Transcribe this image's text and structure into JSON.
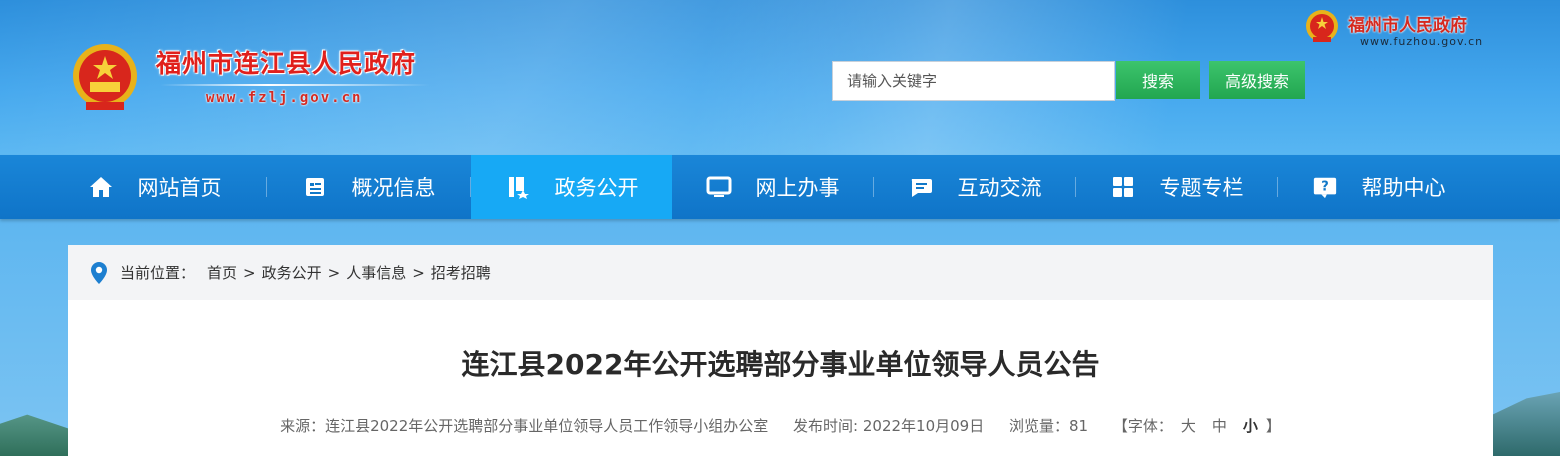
{
  "header": {
    "site_title": "福州市连江县人民政府",
    "site_url": "www.fzlj.gov.cn",
    "parent_site_title": "福州市人民政府",
    "parent_site_url": "www.fuzhou.gov.cn"
  },
  "search": {
    "placeholder": "请输入关键字",
    "value": "",
    "search_label": "搜索",
    "advanced_label": "高级搜索"
  },
  "nav": {
    "items": [
      {
        "label": "网站首页",
        "icon": "home-icon"
      },
      {
        "label": "概况信息",
        "icon": "document-icon"
      },
      {
        "label": "政务公开",
        "icon": "book-icon",
        "active": true
      },
      {
        "label": "网上办事",
        "icon": "monitor-icon"
      },
      {
        "label": "互动交流",
        "icon": "chat-icon"
      },
      {
        "label": "专题专栏",
        "icon": "grid-icon"
      },
      {
        "label": "帮助中心",
        "icon": "help-icon"
      }
    ]
  },
  "breadcrumb": {
    "prefix": "当前位置：",
    "items": [
      "首页",
      "政务公开",
      "人事信息",
      "招考招聘"
    ],
    "separator": ">"
  },
  "article": {
    "title": "连江县2022年公开选聘部分事业单位领导人员公告",
    "source": "来源：连江县2022年公开选聘部分事业单位领导人员工作领导小组办公室",
    "publish_time": "发布时间: 2022年10月09日",
    "views": "浏览量：81",
    "font_size_prefix": "【字体：",
    "font_size_large": "大",
    "font_size_medium": "中",
    "font_size_small": "小",
    "font_size_suffix": "】"
  },
  "colors": {
    "title_red": "#e0201c",
    "button_green": "#22a650",
    "nav_blue": "#0f74c8",
    "nav_active": "#17a9f5"
  }
}
